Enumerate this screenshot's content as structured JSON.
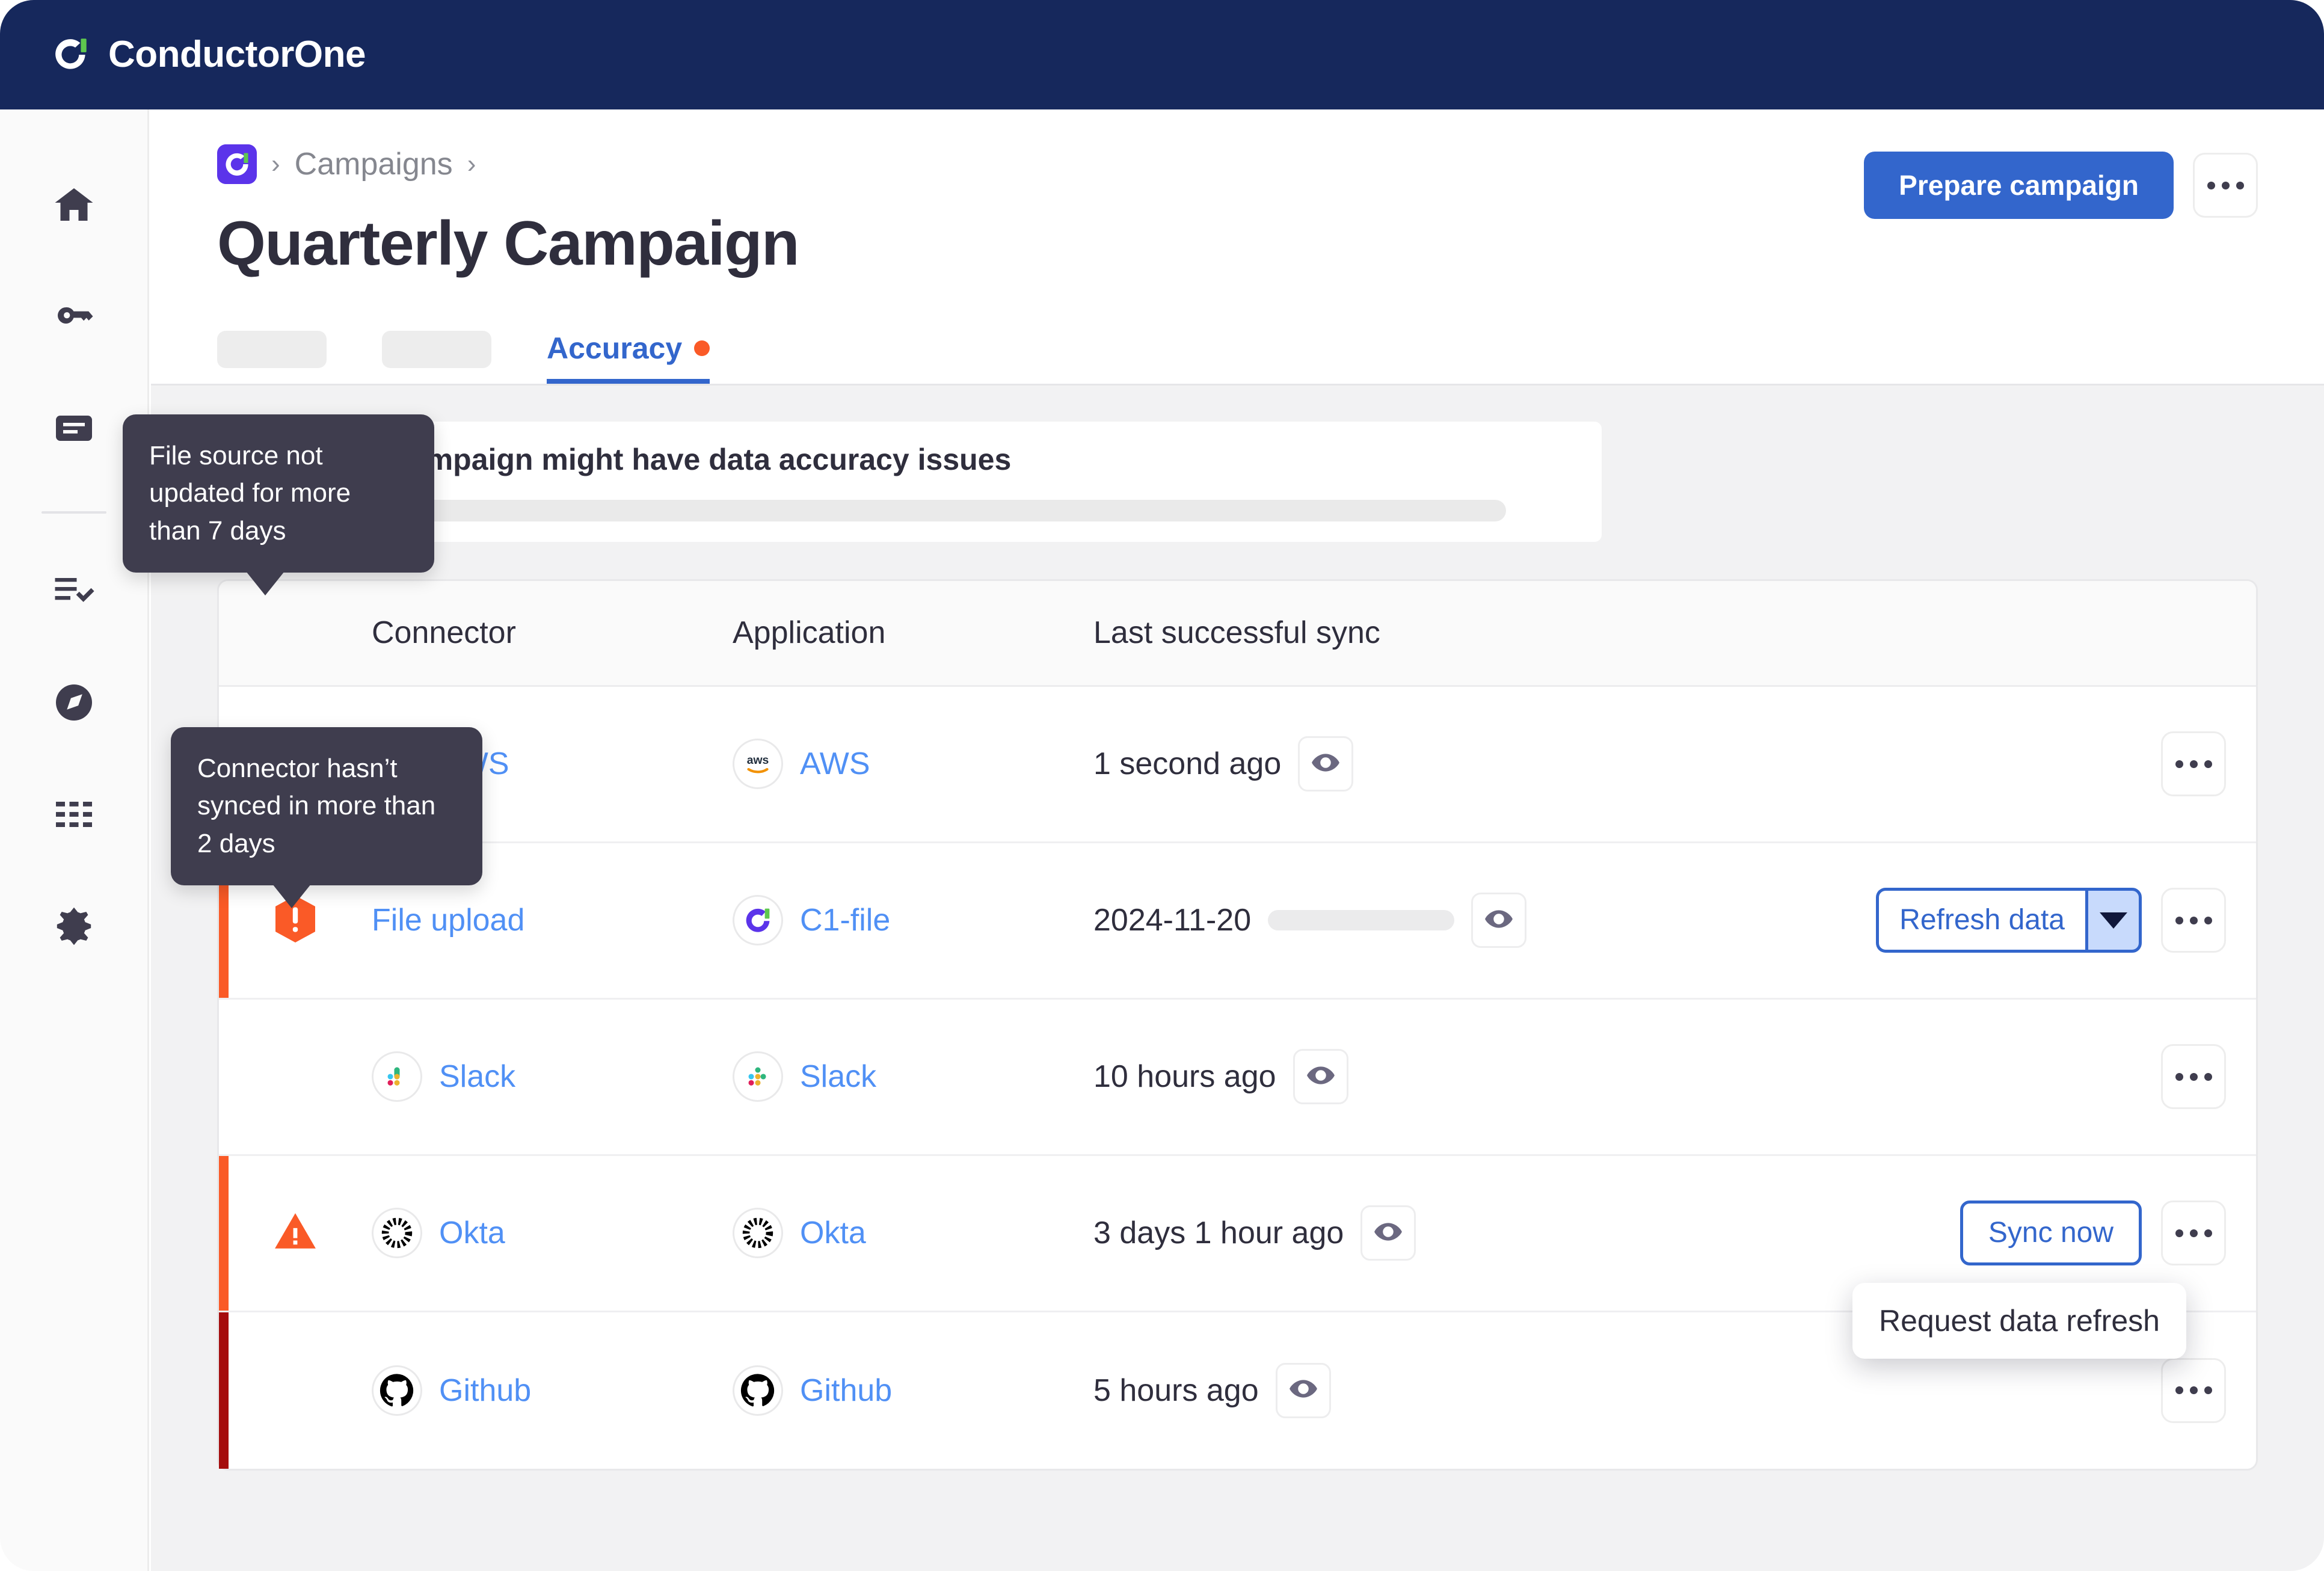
{
  "brand": {
    "name": "ConductorOne",
    "logo_icon": "conductorone-logo-icon"
  },
  "sidebar": {
    "items": [
      {
        "name": "home",
        "icon": "home-icon"
      },
      {
        "name": "access",
        "icon": "key-icon"
      },
      {
        "name": "requests",
        "icon": "document-lines-icon"
      },
      {
        "name": "tasks",
        "icon": "checklist-icon"
      },
      {
        "name": "explore",
        "icon": "compass-icon"
      },
      {
        "name": "apps",
        "icon": "grid-apps-icon"
      },
      {
        "name": "settings",
        "icon": "gear-icon"
      }
    ]
  },
  "header": {
    "breadcrumb": {
      "org_icon": "c1-logo-icon",
      "separator": "›",
      "parent": "Campaigns"
    },
    "title": "Quarterly Campaign",
    "primary_button": "Prepare campaign",
    "overflow_button_icon": "ellipsis-icon"
  },
  "tabs": {
    "items": [
      {
        "label": "",
        "redacted": true
      },
      {
        "label": "",
        "redacted": true
      },
      {
        "label": "Accuracy",
        "active": true,
        "dot_color": "#fa5a27"
      }
    ]
  },
  "alert": {
    "icon": "warning-triangle-icon",
    "title": "Your campaign might have data accuracy issues",
    "body_redacted": true,
    "accent_color": "#fa5a27"
  },
  "table": {
    "columns": [
      "Connector",
      "Application",
      "Last successful sync"
    ],
    "rows": [
      {
        "status": "none",
        "bar_color": "",
        "connector": {
          "label": "AWS",
          "icon": "aws-icon"
        },
        "application": {
          "label": "AWS",
          "icon": "aws-icon"
        },
        "last_sync": "1 second ago",
        "sync_redacted": false,
        "view_icon": "eye-icon",
        "action": null,
        "overflow_icon": "ellipsis-icon"
      },
      {
        "status": "error",
        "bar_color": "#fa5a27",
        "status_icon": "hexagon-alert-icon",
        "connector": {
          "label": "File upload",
          "icon": null
        },
        "application": {
          "label": "C1-file",
          "icon": "c1-logo-icon"
        },
        "last_sync": "2024-11-20",
        "sync_redacted": true,
        "view_icon": "eye-icon",
        "action": {
          "type": "split",
          "label": "Refresh data",
          "caret_icon": "chevron-down-icon"
        },
        "overflow_icon": "ellipsis-icon",
        "menu": {
          "items": [
            "Request data refresh"
          ]
        }
      },
      {
        "status": "none",
        "bar_color": "",
        "connector": {
          "label": "Slack",
          "icon": "slack-icon"
        },
        "application": {
          "label": "Slack",
          "icon": "slack-icon"
        },
        "last_sync": "10 hours ago",
        "sync_redacted": false,
        "view_icon": "eye-icon",
        "action": null,
        "overflow_icon": "ellipsis-icon"
      },
      {
        "status": "warning",
        "bar_color": "#fa5a27",
        "status_icon": "warning-triangle-icon",
        "connector": {
          "label": "Okta",
          "icon": "okta-icon"
        },
        "application": {
          "label": "Okta",
          "icon": "okta-icon"
        },
        "last_sync": "3 days 1 hour ago",
        "sync_redacted": false,
        "view_icon": "eye-icon",
        "action": {
          "type": "outline",
          "label": "Sync now"
        },
        "overflow_icon": "ellipsis-icon"
      },
      {
        "status": "none",
        "bar_color": "#a50d0d",
        "connector": {
          "label": "Github",
          "icon": "github-icon"
        },
        "application": {
          "label": "Github",
          "icon": "github-icon"
        },
        "last_sync": "5 hours ago",
        "sync_redacted": false,
        "view_icon": "eye-icon",
        "action": null,
        "overflow_icon": "ellipsis-icon"
      }
    ]
  },
  "tooltips": [
    {
      "id": "file-source",
      "text": "File source not updated for more than 7 days"
    },
    {
      "id": "connector-sync",
      "text": "Connector hasn’t synced in more than 2 days"
    }
  ],
  "colors": {
    "topbar": "#16285c",
    "accent_blue": "#3366cc",
    "link_blue": "#5090f5",
    "alert_orange": "#fa5a27",
    "critical_red": "#a50d0d",
    "brand_green": "#5ec84e",
    "brand_purple": "#5b34ea"
  }
}
